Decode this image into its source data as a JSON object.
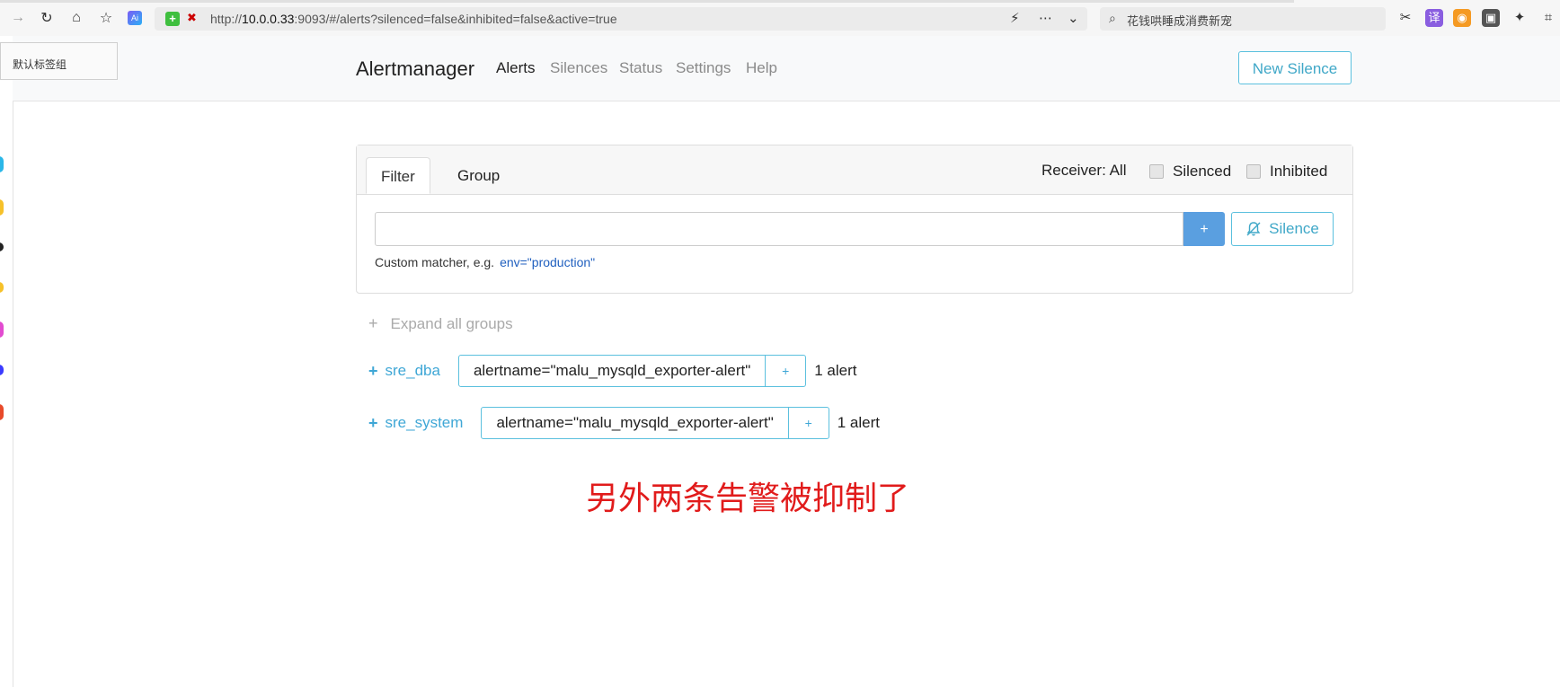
{
  "browser": {
    "url_prefix": "http://",
    "url_host": "10.0.0.33",
    "url_suffix": ":9093/#/alerts?silenced=false&inhibited=false&active=true",
    "search_text": "花钱哄睡成消费新宠",
    "ai_badge": "Ai",
    "tab_group_popup": "默认标签组"
  },
  "navbar": {
    "brand": "Alertmanager",
    "links": [
      "Alerts",
      "Silences",
      "Status",
      "Settings",
      "Help"
    ],
    "new_silence": "New Silence"
  },
  "filter_panel": {
    "tabs": [
      "Filter",
      "Group"
    ],
    "receiver": "Receiver: All",
    "silenced_label": "Silenced",
    "inhibited_label": "Inhibited",
    "filter_input_value": "",
    "add_button": "+",
    "silence_button": "Silence",
    "hint": "Custom matcher, e.g.",
    "hint_example": "env=\"production\""
  },
  "groups": {
    "expand_all": "Expand all groups",
    "items": [
      {
        "receiver": "sre_dba",
        "matcher": "alertname=\"malu_mysqld_exporter-alert\"",
        "add": "+",
        "count": "1 alert"
      },
      {
        "receiver": "sre_system",
        "matcher": "alertname=\"malu_mysqld_exporter-alert\"",
        "add": "+",
        "count": "1 alert"
      }
    ]
  },
  "annotation": "另外两条告警被抑制了",
  "colors": {
    "accent": "#5bc0de",
    "primary": "#5a9fe0",
    "annotation": "#e11b1b"
  }
}
